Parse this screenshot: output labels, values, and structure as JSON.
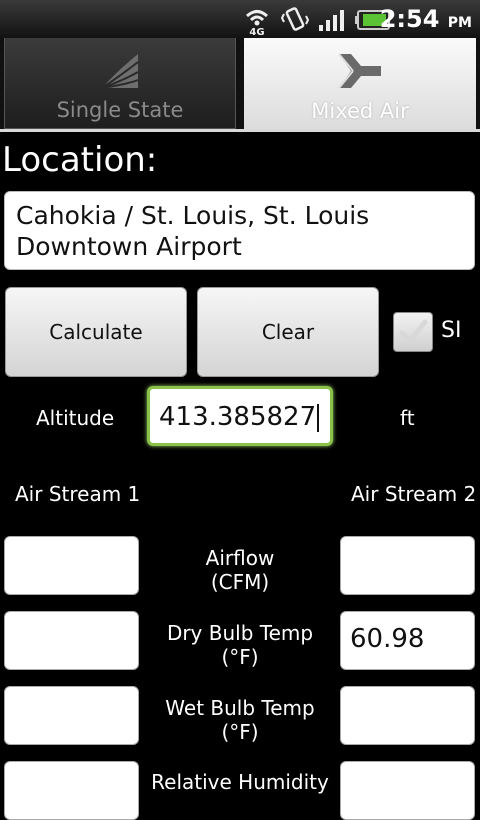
{
  "status_bar": {
    "time": "2:54",
    "ampm": "PM",
    "network": "4G",
    "icons": [
      "4g-signal-icon",
      "vibrate-icon",
      "cell-signal-icon",
      "battery-icon"
    ]
  },
  "tabs": [
    {
      "label": "Single State",
      "icon": "single-state-icon",
      "selected": false
    },
    {
      "label": "Mixed Air",
      "icon": "mixed-air-icon",
      "selected": true
    }
  ],
  "location": {
    "label": "Location:",
    "line1": "Cahokia / St. Louis, St. Louis",
    "line2": "Downtown Airport"
  },
  "actions": {
    "calculate": "Calculate",
    "clear": "Clear",
    "si_label": "SI",
    "si_checked": true
  },
  "altitude": {
    "label": "Altitude",
    "value": "413.385827",
    "unit": "ft"
  },
  "streams": {
    "left_label": "Air Stream 1",
    "right_label": "Air Stream 2"
  },
  "rows": [
    {
      "line1": "Airflow",
      "line2": "(CFM)",
      "left": "",
      "right": ""
    },
    {
      "line1": "Dry Bulb Temp",
      "line2": "(°F)",
      "left": "",
      "right": "60.98"
    },
    {
      "line1": "Wet Bulb Temp",
      "line2": "(°F)",
      "left": "",
      "right": ""
    },
    {
      "line1": "Relative Humidity",
      "line2": "",
      "left": "",
      "right": ""
    }
  ]
}
